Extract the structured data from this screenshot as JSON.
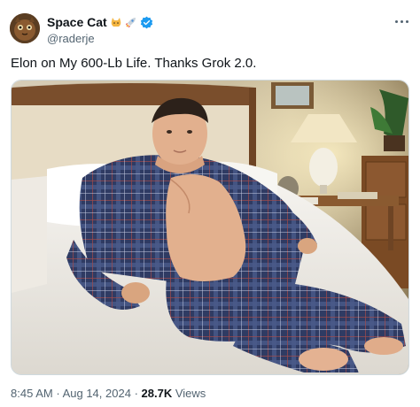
{
  "author": {
    "display_name": "Space Cat",
    "handle": "@raderje",
    "badges": [
      "cat-emoji-icon",
      "rocket-emoji-icon",
      "verified-badge-icon"
    ]
  },
  "tweet": {
    "text": "Elon on My 600-Lb Life. Thanks Grok 2.0."
  },
  "meta": {
    "time": "8:45 AM",
    "separator1": "·",
    "date": "Aug 14, 2024",
    "separator2": "·",
    "views_count": "28.7K",
    "views_label": "Views"
  },
  "colors": {
    "verified": "#1d9bf0",
    "secondary_text": "#536471",
    "primary_text": "#0f1419"
  }
}
